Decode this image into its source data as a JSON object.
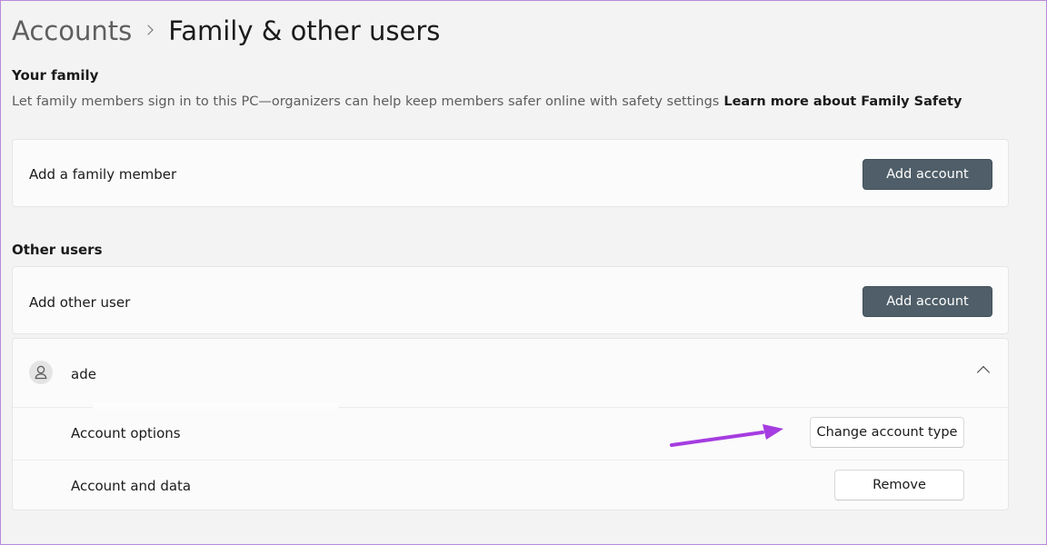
{
  "breadcrumb": {
    "parent": "Accounts",
    "current": "Family & other users"
  },
  "family": {
    "title": "Your family",
    "description": "Let family members sign in to this PC—organizers can help keep members safer online with safety settings",
    "learn_more": "Learn more about Family Safety",
    "add_label": "Add a family member",
    "add_button": "Add account"
  },
  "other_users": {
    "title": "Other users",
    "add_label": "Add other user",
    "add_button": "Add account",
    "user": {
      "name": "ade",
      "account_options_label": "Account options",
      "change_type_button": "Change account type",
      "account_data_label": "Account and data",
      "remove_button": "Remove"
    }
  },
  "colors": {
    "accent_button": "#4f5e68",
    "annotation_arrow": "#a53de0"
  }
}
